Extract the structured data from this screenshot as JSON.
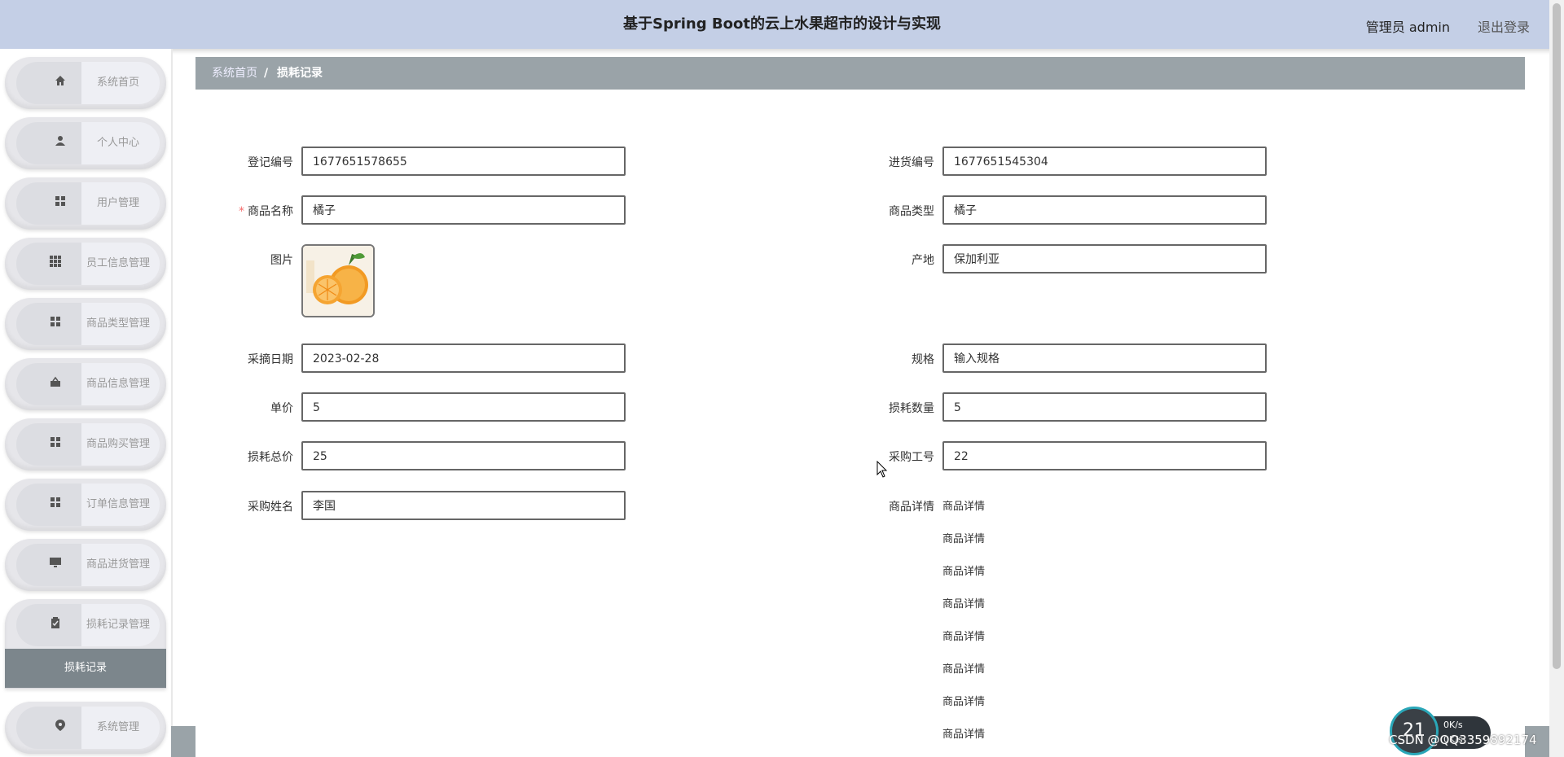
{
  "header": {
    "title": "基于Spring Boot的云上水果超市的设计与实现",
    "user": "管理员 admin",
    "logout": "退出登录"
  },
  "sidebar": {
    "items": [
      {
        "label": "系统首页",
        "icon": "home-icon"
      },
      {
        "label": "个人中心",
        "icon": "user-icon"
      },
      {
        "label": "用户管理",
        "icon": "grid-icon"
      },
      {
        "label": "员工信息管理",
        "icon": "apps-icon"
      },
      {
        "label": "商品类型管理",
        "icon": "grid-icon"
      },
      {
        "label": "商品信息管理",
        "icon": "goods-icon"
      },
      {
        "label": "商品购买管理",
        "icon": "grid-icon"
      },
      {
        "label": "订单信息管理",
        "icon": "grid-icon"
      },
      {
        "label": "商品进货管理",
        "icon": "monitor-icon"
      },
      {
        "label": "损耗记录管理",
        "icon": "clipboard-icon"
      },
      {
        "label": "系统管理",
        "icon": "location-icon"
      }
    ],
    "active_sub": "损耗记录"
  },
  "breadcrumb": {
    "home": "系统首页",
    "separator": "/",
    "current": "损耗记录"
  },
  "form": {
    "register_no": {
      "label": "登记编号",
      "value": "1677651578655"
    },
    "purchase_no": {
      "label": "进货编号",
      "value": "1677651545304"
    },
    "product_name": {
      "label": "商品名称",
      "required_mark": "*",
      "value": "橘子"
    },
    "product_type": {
      "label": "商品类型",
      "value": "橘子"
    },
    "picture": {
      "label": "图片"
    },
    "origin": {
      "label": "产地",
      "value": "保加利亚"
    },
    "pick_date": {
      "label": "采摘日期",
      "value": "2023-02-28"
    },
    "spec": {
      "label": "规格",
      "value": "输入规格"
    },
    "unit_price": {
      "label": "单价",
      "value": "5"
    },
    "loss_qty": {
      "label": "损耗数量",
      "value": "5"
    },
    "loss_total": {
      "label": "损耗总价",
      "value": "25"
    },
    "buyer_id": {
      "label": "采购工号",
      "value": "22"
    },
    "buyer_name": {
      "label": "采购姓名",
      "value": "李国"
    },
    "details": {
      "label": "商品详情",
      "lines": [
        "商品详情",
        "商品详情",
        "商品详情",
        "商品详情",
        "商品详情",
        "商品详情",
        "商品详情",
        "商品详情"
      ]
    }
  },
  "speed_widget": {
    "value": "21",
    "up": "0K/s",
    "down": "0K/s"
  },
  "watermark": "CSDN @QQ3359892174",
  "colors": {
    "header_bg": "#c4cfe6",
    "breadcrumb_bg": "#9aa3a8",
    "submenu_bg": "#7c868c",
    "required": "#f56c6c"
  }
}
